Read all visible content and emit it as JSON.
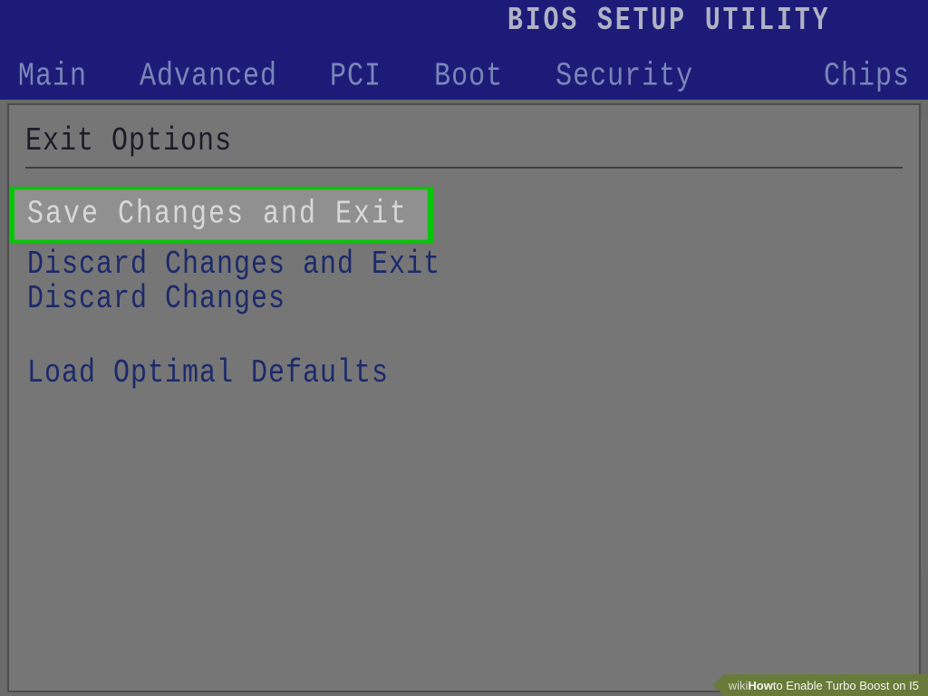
{
  "header": {
    "title": "BIOS SETUP UTILITY"
  },
  "tabs": {
    "items": [
      "Main",
      "Advanced",
      "PCI",
      "Boot",
      "Security",
      "Chips"
    ]
  },
  "content": {
    "section_title": "Exit Options",
    "highlighted": "Save Changes and Exit",
    "items": [
      "Discard Changes and Exit",
      "Discard Changes"
    ],
    "secondary_items": [
      "Load Optimal Defaults"
    ]
  },
  "footer": {
    "wiki": "wiki",
    "how": "How ",
    "rest": "to Enable Turbo Boost on I5"
  }
}
